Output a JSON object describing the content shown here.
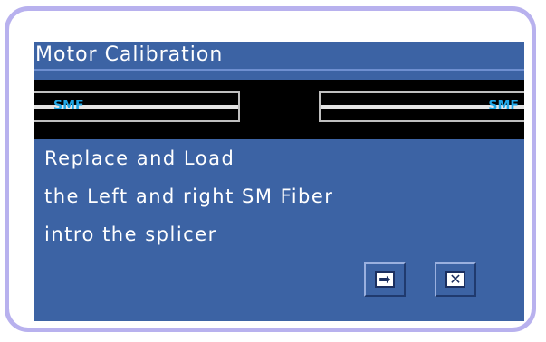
{
  "dialog": {
    "title": "Motor Calibration",
    "fiber_left_label": "SMF",
    "fiber_right_label": "SMF",
    "message_lines": [
      "Replace and Load",
      "the Left and right SM Fiber",
      "intro the splicer"
    ],
    "buttons": {
      "next_glyph": "➡",
      "close_glyph": "✕"
    },
    "colors": {
      "panel_blue": "#3c63a4",
      "frame_border": "#b8b1ee",
      "fiber_label": "#20a8e8"
    }
  }
}
